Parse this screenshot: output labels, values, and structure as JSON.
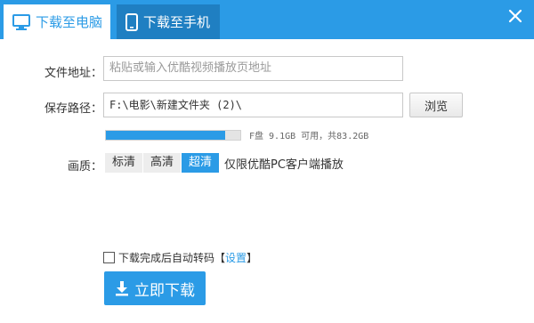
{
  "tabs": [
    {
      "label": "下载至电脑",
      "icon": "monitor-icon",
      "active": true
    },
    {
      "label": "下载至手机",
      "icon": "phone-icon",
      "active": false
    }
  ],
  "colors": {
    "accent": "#2b9be6",
    "tab_inactive": "#1f7fc2"
  },
  "form": {
    "url_label": "文件地址：",
    "url_placeholder": "粘贴或输入优酷视频播放页地址",
    "path_label": "保存路径：",
    "path_value": "F:\\电影\\新建文件夹 (2)\\",
    "browse_label": "浏览",
    "disk_used_fraction": 0.89,
    "disk_info": "F盘 9.1GB 可用，共83.2GB",
    "quality_label": "画质：",
    "quality_options": [
      "标清",
      "高清",
      "超清"
    ],
    "quality_selected": "超清",
    "quality_note": "仅限优酷PC客户端播放"
  },
  "footer": {
    "auto_convert_prefix": "下载完成后自动转码【",
    "auto_convert_link": "设置",
    "auto_convert_suffix": "】",
    "auto_convert_checked": false,
    "download_label": "立即下载"
  }
}
